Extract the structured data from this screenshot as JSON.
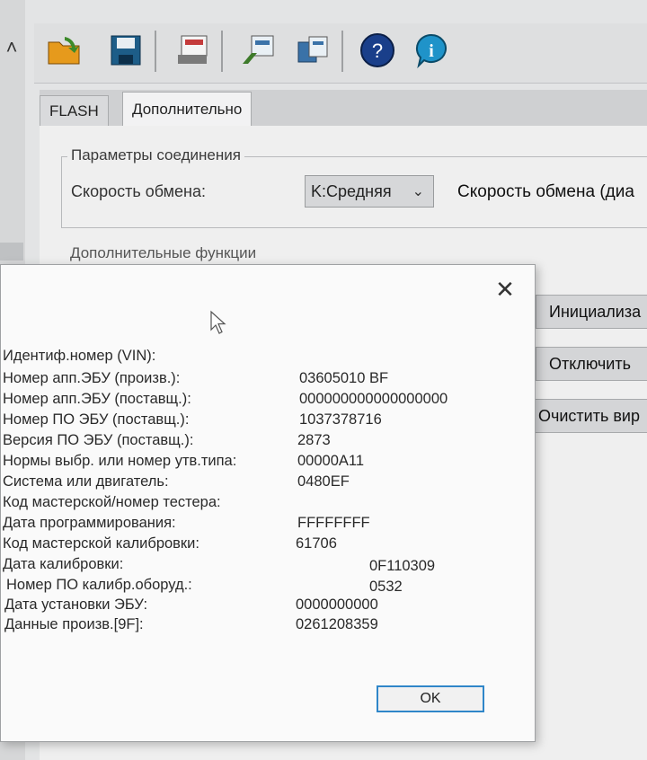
{
  "background_app": {
    "tabs": [
      {
        "label": "FLASH"
      },
      {
        "label": "Дополнительно"
      }
    ],
    "connection_group": {
      "title": "Параметры соединения",
      "speed_label": "Скорость обмена:",
      "speed_value": "K:Средняя",
      "speed_description": "Скорость обмена (диа"
    },
    "extra_functions_title": "Дополнительные функции",
    "side_buttons": [
      {
        "label": "Инициализа"
      },
      {
        "label": "Отключить"
      },
      {
        "label": "Очистить вир"
      }
    ],
    "toolbar_icons": [
      "open-folder-icon",
      "save-disk-icon",
      "write-ecu-icon",
      "read-ecu-icon",
      "compare-icon",
      "help-icon",
      "info-icon"
    ]
  },
  "dialog": {
    "rows": [
      {
        "label": "Идентиф.номер (VIN):",
        "value": ""
      },
      {
        "label": "Номер апп.ЭБУ (произв.):",
        "value": "03605010 BF"
      },
      {
        "label": "Номер апп.ЭБУ (поставщ.):",
        "value": "000000000000000000"
      },
      {
        "label": "Номер ПО ЭБУ (поставщ.):",
        "value": "1037378716"
      },
      {
        "label": "Версия ПО ЭБУ (поставщ.):",
        "value": "2873"
      },
      {
        "label": "Нормы выбр. или номер утв.типа:",
        "value": "00000A11"
      },
      {
        "label": "Система или двигатель:",
        "value": "0480EF"
      },
      {
        "label": "Код мастерской/номер тестера:",
        "value": ""
      },
      {
        "label": "Дата программирования:",
        "value": "FFFFFFFF"
      },
      {
        "label": "Код мастерской калибровки:",
        "value": "61706"
      },
      {
        "label": "Дата калибровки:",
        "value": "0F110309"
      },
      {
        "label": "Номер ПО калибр.оборуд.:",
        "value": "0532"
      },
      {
        "label": "Дата установки ЭБУ:",
        "value": "0000000000"
      },
      {
        "label": "Данные произв.[9F]:",
        "value": "0261208359"
      }
    ],
    "ok_label": "OK"
  }
}
